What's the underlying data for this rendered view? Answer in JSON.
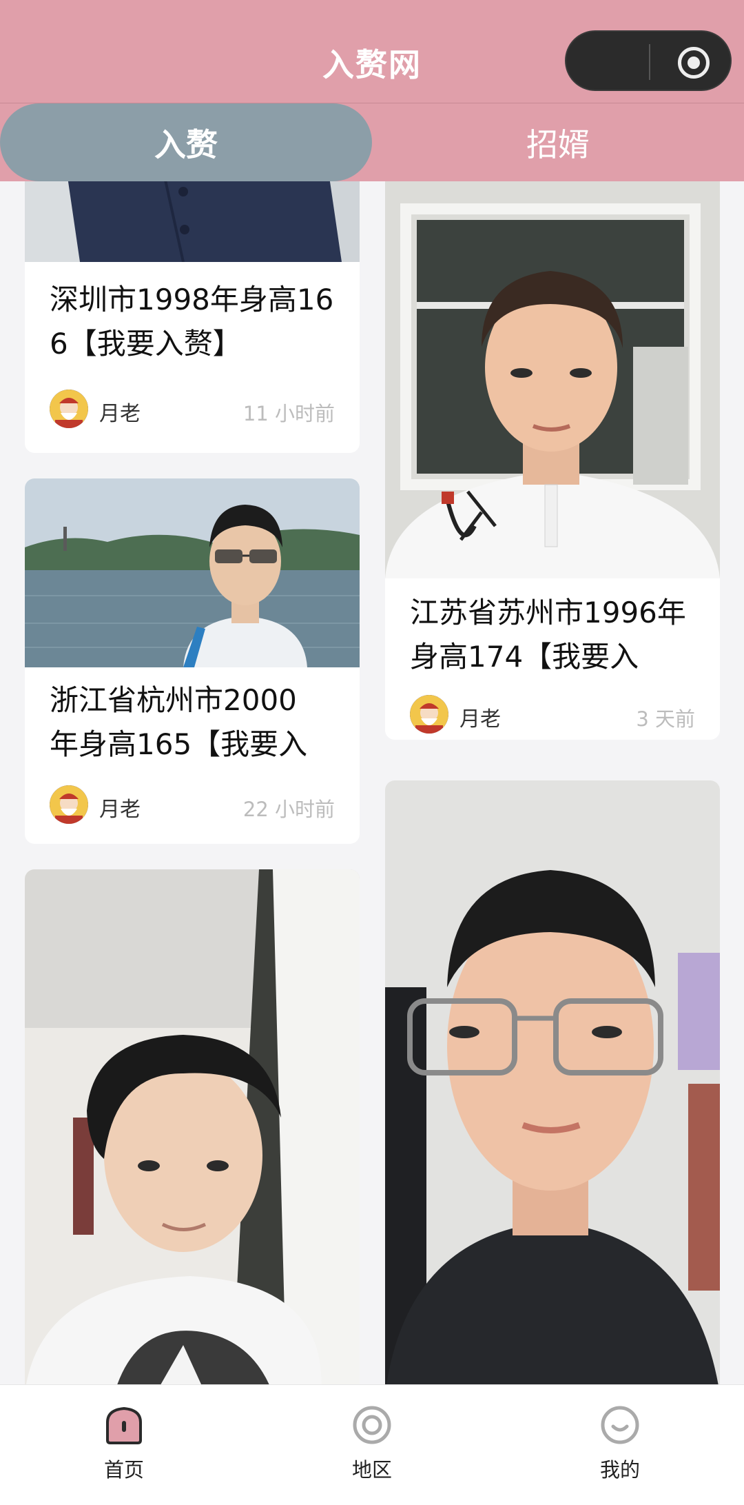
{
  "header": {
    "title": "入赘网"
  },
  "tabs": [
    {
      "label": "入赘"
    },
    {
      "label": "招婿"
    }
  ],
  "cards": [
    {
      "title": "深圳市1998年身高16\n6【我要入赘】",
      "author": "月老",
      "time": "11 小时前"
    },
    {
      "title": "浙江省杭州市2000\n年身高165【我要入",
      "author": "月老",
      "time": "22 小时前"
    },
    {
      "title": "江苏省苏州市1996年\n身高174【我要入",
      "author": "月老",
      "time": "3 天前"
    }
  ],
  "bottom_nav": [
    {
      "label": "首页",
      "icon": "home-icon"
    },
    {
      "label": "地区",
      "icon": "region-icon"
    },
    {
      "label": "我的",
      "icon": "profile-icon"
    }
  ],
  "colors": {
    "header": "#e09faa",
    "active_tab": "#8c9ea8"
  }
}
